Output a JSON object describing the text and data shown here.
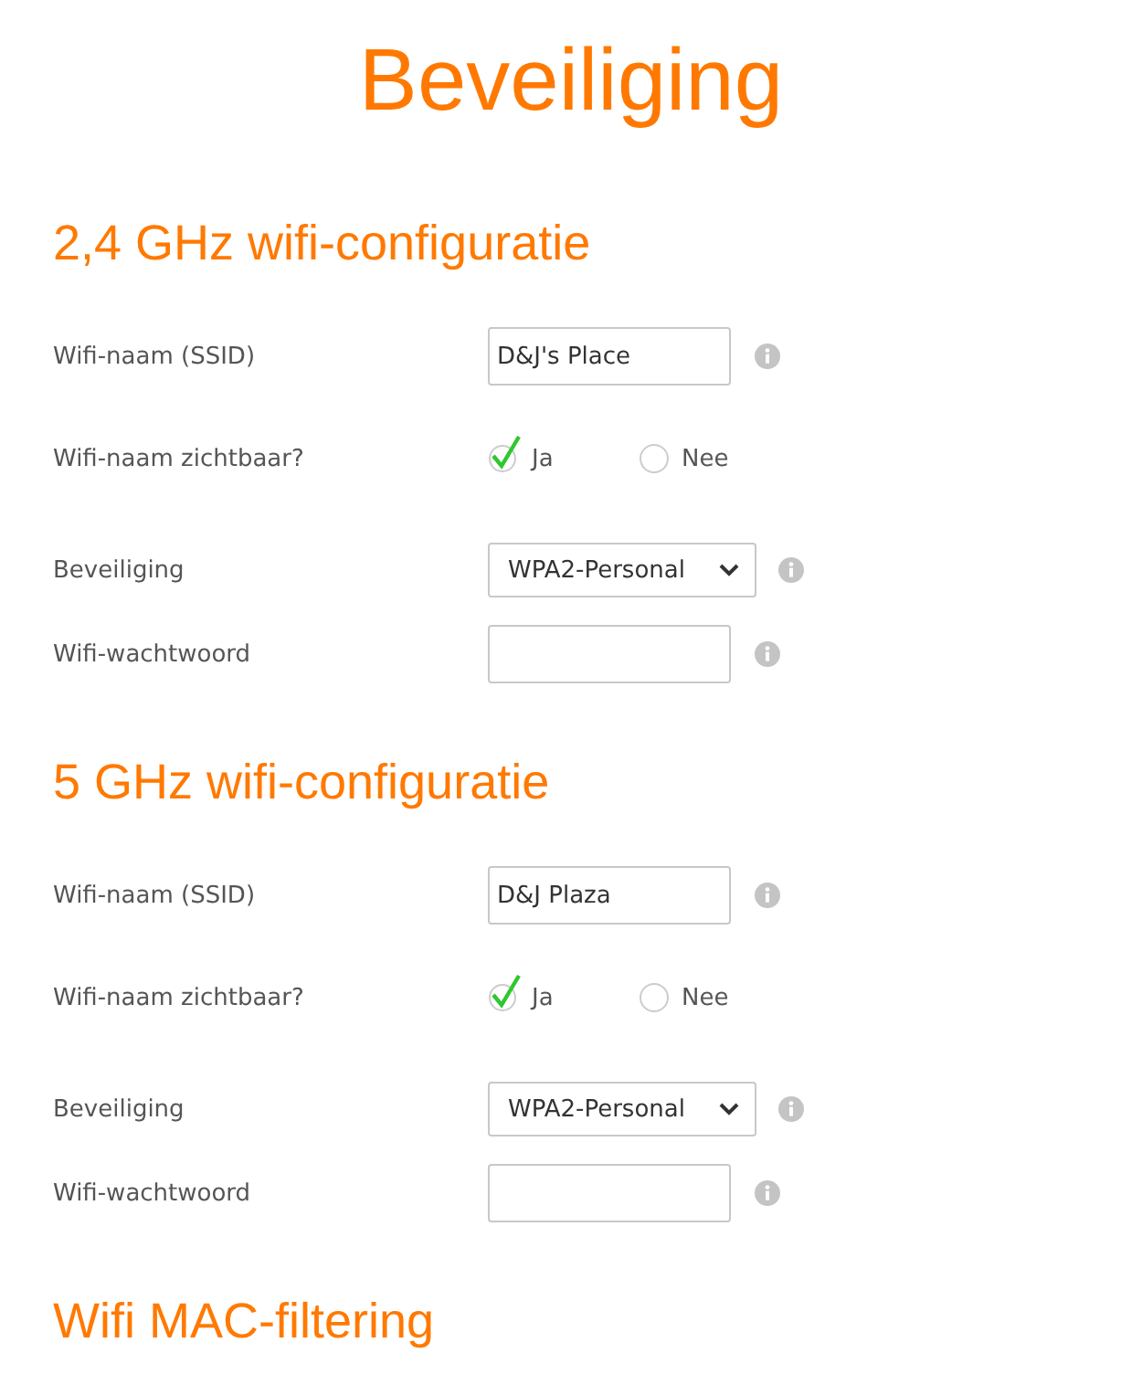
{
  "title": "Beveiliging",
  "sections": [
    {
      "heading": "2,4 GHz wifi-configuratie",
      "fields": [
        {
          "kind": "text",
          "label": "Wifi-naam (SSID)",
          "value": "D&J's Place"
        },
        {
          "kind": "radio",
          "label": "Wifi-naam zichtbaar?",
          "options": [
            {
              "label": "Ja",
              "selected": true
            },
            {
              "label": "Nee",
              "selected": false
            }
          ]
        },
        {
          "kind": "select",
          "label": "Beveiliging",
          "value": "WPA2-Personal"
        },
        {
          "kind": "password",
          "label": "Wifi-wachtwoord"
        }
      ]
    },
    {
      "heading": "5 GHz wifi-configuratie",
      "fields": [
        {
          "kind": "text",
          "label": "Wifi-naam (SSID)",
          "value": "D&J Plaza"
        },
        {
          "kind": "radio",
          "label": "Wifi-naam zichtbaar?",
          "options": [
            {
              "label": "Ja",
              "selected": true
            },
            {
              "label": "Nee",
              "selected": false
            }
          ]
        },
        {
          "kind": "select",
          "label": "Beveiliging",
          "value": "WPA2-Personal"
        },
        {
          "kind": "password",
          "label": "Wifi-wachtwoord"
        }
      ]
    },
    {
      "heading": "Wifi MAC-filtering"
    }
  ]
}
